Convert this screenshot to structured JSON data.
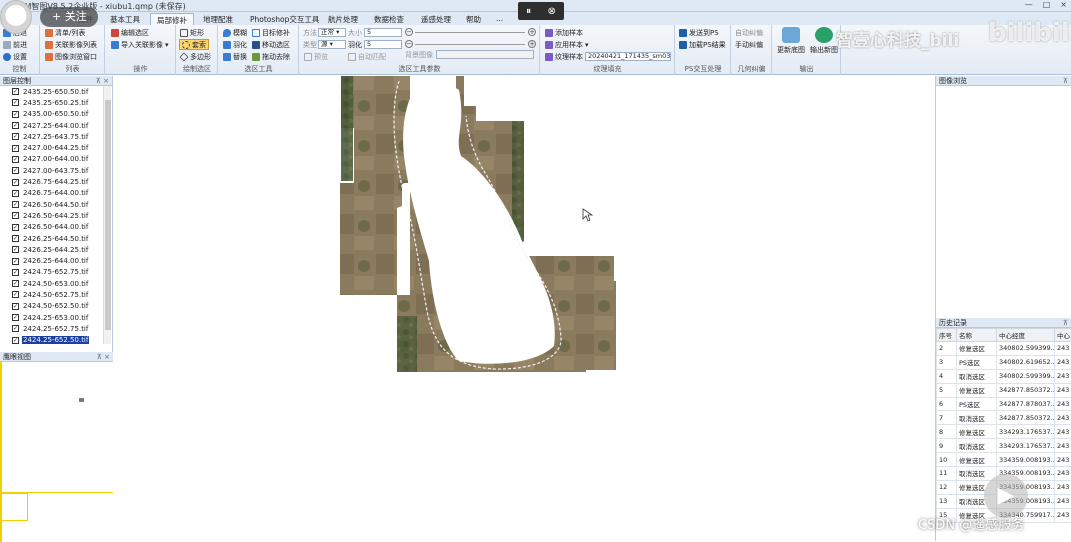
{
  "app": {
    "title": "MCM智图V8.5.2企业版 - xiubu1.qmp (未保存)",
    "controls": [
      "—",
      "□",
      "×"
    ]
  },
  "tabs": [
    "文件",
    "基本工具",
    "局部修补",
    "地理配准",
    "Photoshop交互工具",
    "航片处理",
    "数据检查",
    "遥感处理",
    "帮助",
    "..."
  ],
  "ribbon": {
    "control": {
      "items": [
        "后退",
        "前进",
        "设置"
      ],
      "label": "控制"
    },
    "list": {
      "items": [
        "清单/列表",
        "关联影像列表",
        "图像浏览窗口"
      ],
      "label": "列表"
    },
    "ops": {
      "items": [
        "编辑选区",
        "导入关联影像"
      ],
      "label": "操作"
    },
    "draw": {
      "items": [
        "矩形",
        "套索",
        "多边形"
      ],
      "label": "绘制选区"
    },
    "tools": {
      "items": [
        "模糊",
        "目标修补",
        "羽化",
        "移动选区",
        "替换",
        "拖动去除"
      ],
      "label": "选区工具"
    },
    "params": {
      "method_label": "方法",
      "method_value": "正常",
      "size_label": "大小",
      "size_value": "5",
      "type_label": "类型",
      "type_value": "源",
      "feather_label": "羽化",
      "feather_value": "5",
      "preview_label": "预览",
      "auto_label": "自动匹配",
      "texture_label": "背景图像",
      "label": "选区工具参数"
    },
    "texture": {
      "items": [
        "添加样本",
        "应用样本",
        "纹理样本"
      ],
      "sample_value": "20240421_171435_sm03.tif",
      "label": "纹理填充"
    },
    "ps": {
      "items": [
        "发送到PS",
        "加载PS结果"
      ],
      "label": "PS交互处理"
    },
    "geo": {
      "items": [
        "自动纠偏",
        "手动纠偏"
      ],
      "label": "几何纠偏"
    },
    "output": {
      "items": [
        "更新底图",
        "输出新图"
      ],
      "label": "输出"
    }
  },
  "layers_panel": {
    "title": "图层控制",
    "layers": [
      "2435.25-650.50.tif",
      "2435.25-650.25.tif",
      "2435.00-650.50.tif",
      "2427.25-644.00.tif",
      "2427.25-643.75.tif",
      "2427.00-644.25.tif",
      "2427.00-644.00.tif",
      "2427.00-643.75.tif",
      "2426.75-644.25.tif",
      "2426.75-644.00.tif",
      "2426.50-644.50.tif",
      "2426.50-644.25.tif",
      "2426.50-644.00.tif",
      "2426.25-644.50.tif",
      "2426.25-644.25.tif",
      "2426.25-644.00.tif",
      "2424.75-652.75.tif",
      "2424.50-653.00.tif",
      "2424.50-652.75.tif",
      "2424.50-652.50.tif",
      "2424.25-653.00.tif",
      "2424.25-652.75.tif",
      "2424.25-652.50.tif"
    ],
    "selected_index": 22
  },
  "eagle_panel": {
    "title": "鹰眼视图"
  },
  "preview_panel": {
    "title": "图像浏览"
  },
  "history": {
    "title": "历史记录",
    "columns": [
      "序号",
      "名称",
      "中心经度",
      "中心"
    ],
    "rows": [
      [
        "2",
        "修复选区",
        "340802.599399...",
        "243"
      ],
      [
        "3",
        "PS选区",
        "340802.619652...",
        "243"
      ],
      [
        "4",
        "取消选区",
        "340802.599399...",
        "243"
      ],
      [
        "5",
        "修复选区",
        "342877.850372...",
        "243"
      ],
      [
        "6",
        "PS选区",
        "342877.878037...",
        "243"
      ],
      [
        "7",
        "取消选区",
        "342877.850372...",
        "243"
      ],
      [
        "8",
        "修复选区",
        "334293.176537...",
        "243"
      ],
      [
        "9",
        "取消选区",
        "334293.176537...",
        "243"
      ],
      [
        "10",
        "修复选区",
        "334359.008193...",
        "243"
      ],
      [
        "11",
        "取消选区",
        "334359.008193...",
        "243"
      ],
      [
        "12",
        "修复选区",
        "334359.008193...",
        "243"
      ],
      [
        "13",
        "取消选区",
        "334359.008193...",
        "243"
      ],
      [
        "15",
        "修复选区",
        "334340.759917...",
        "243"
      ]
    ]
  },
  "overlays": {
    "follow": "+ 关注",
    "watermark": "智壹心科技_bili",
    "bili": "bilibili",
    "csdn": "CSDN @遥感服务",
    "pause": "⏸",
    "close": "⊗"
  },
  "colors": {
    "ribbon": "#e3ebf5",
    "accent": "#1a3fa0",
    "panel_header": "#dfe9f5"
  }
}
